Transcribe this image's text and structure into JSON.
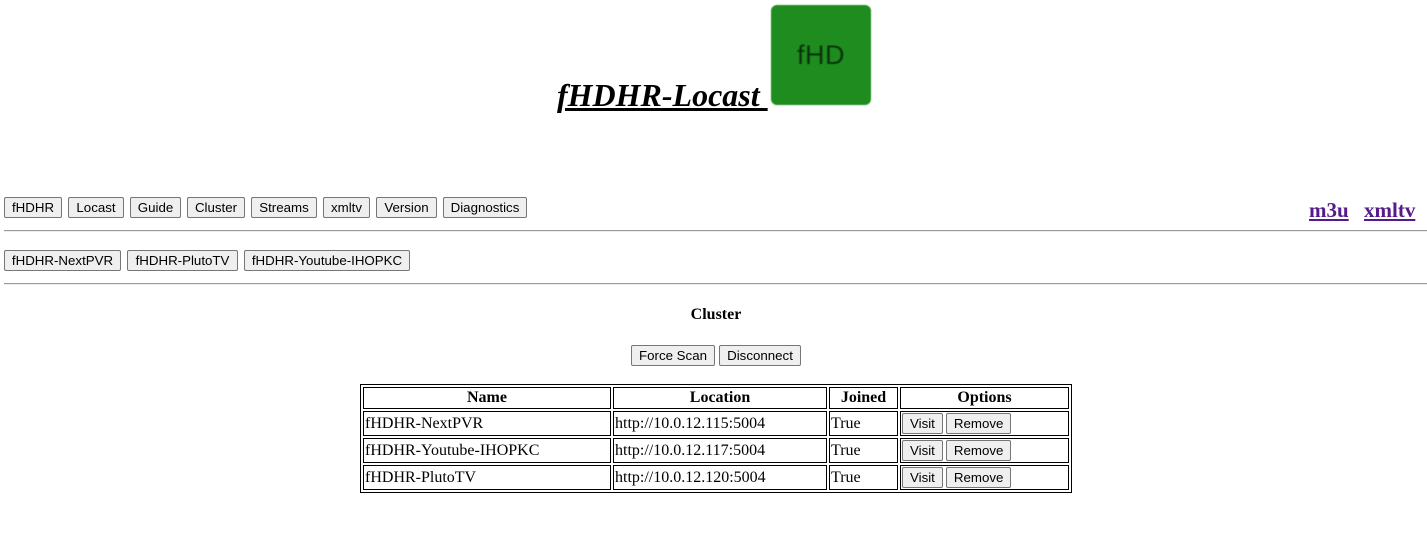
{
  "header": {
    "title": "fHDHR-Locast ",
    "logo_text": "fHD",
    "logo_color": "#1e8c1e"
  },
  "nav": {
    "buttons": [
      "fHDHR",
      "Locast",
      "Guide",
      "Cluster",
      "Streams",
      "xmltv",
      "Version",
      "Diagnostics"
    ],
    "links": [
      "m3u",
      "xmltv"
    ]
  },
  "cluster_nav": {
    "buttons": [
      "fHDHR-NextPVR",
      "fHDHR-PlutoTV",
      "fHDHR-Youtube-IHOPKC"
    ]
  },
  "main": {
    "heading": "Cluster",
    "actions": [
      "Force Scan",
      "Disconnect"
    ],
    "table": {
      "headers": [
        "Name",
        "Location",
        "Joined",
        "Options"
      ],
      "rows": [
        {
          "name": "fHDHR-NextPVR",
          "location": "http://10.0.12.115:5004",
          "joined": "True",
          "visit": "Visit",
          "remove": "Remove"
        },
        {
          "name": "fHDHR-Youtube-IHOPKC",
          "location": "http://10.0.12.117:5004",
          "joined": "True",
          "visit": "Visit",
          "remove": "Remove"
        },
        {
          "name": "fHDHR-PlutoTV",
          "location": "http://10.0.12.120:5004",
          "joined": "True",
          "visit": "Visit",
          "remove": "Remove"
        }
      ]
    }
  },
  "colors": {
    "link_visited": "#551a8b",
    "button_bg": "#efefef"
  }
}
